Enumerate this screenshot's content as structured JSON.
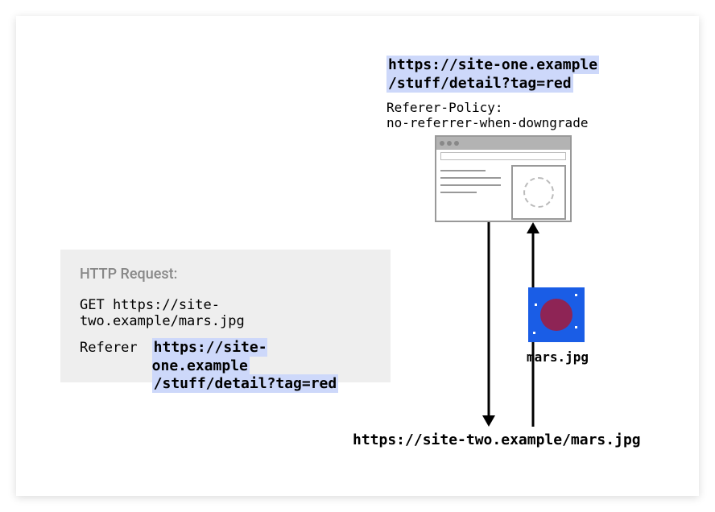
{
  "top_url_line1": "https://site-one.example",
  "top_url_line2": "/stuff/detail?tag=red",
  "referer_policy_line1": "Referer-Policy:",
  "referer_policy_line2": "no-referrer-when-downgrade",
  "http_request": {
    "label": "HTTP Request:",
    "get_line": "GET https://site-two.example/mars.jpg",
    "referer_key": "Referer",
    "referer_val_line1": "https://site-one.example",
    "referer_val_line2": "/stuff/detail?tag=red"
  },
  "mars_caption": "mars.jpg",
  "bottom_url": "https://site-two.example/mars.jpg"
}
